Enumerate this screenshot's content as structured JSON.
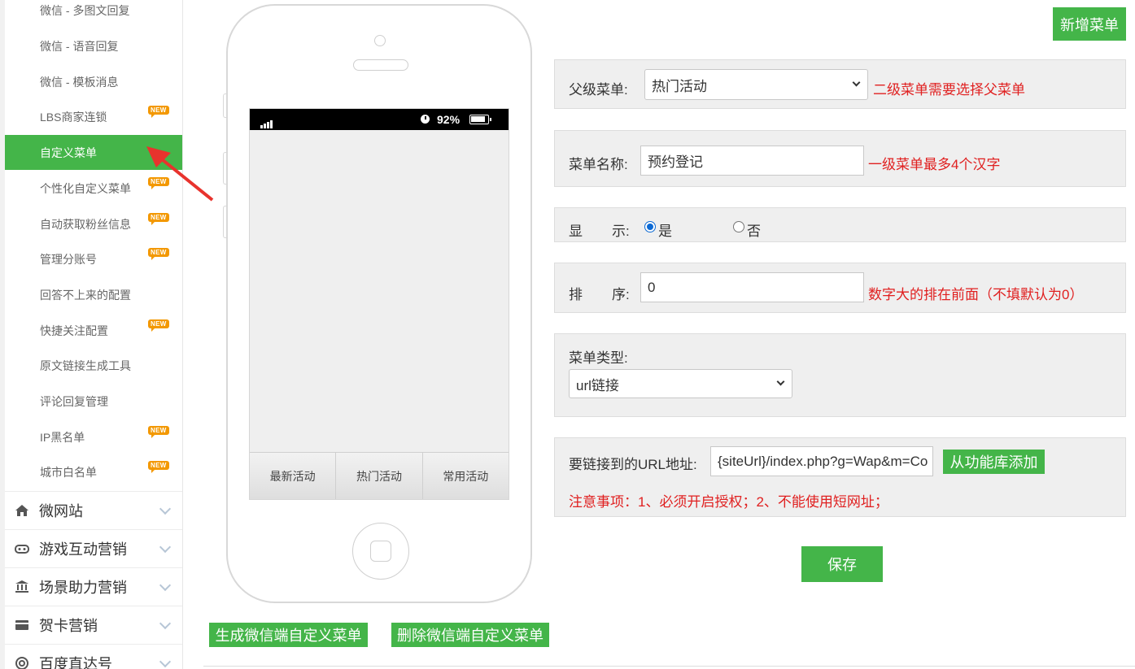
{
  "sidebar": {
    "sub_items": [
      {
        "label": "微信 - 多图文回复",
        "new": false,
        "active": false
      },
      {
        "label": "微信 - 语音回复",
        "new": false,
        "active": false
      },
      {
        "label": "微信 - 模板消息",
        "new": false,
        "active": false
      },
      {
        "label": "LBS商家连锁",
        "new": true,
        "active": false
      },
      {
        "label": "自定义菜单",
        "new": false,
        "active": true
      },
      {
        "label": "个性化自定义菜单",
        "new": true,
        "active": false
      },
      {
        "label": "自动获取粉丝信息",
        "new": true,
        "active": false
      },
      {
        "label": "管理分账号",
        "new": true,
        "active": false
      },
      {
        "label": "回答不上来的配置",
        "new": false,
        "active": false
      },
      {
        "label": "快捷关注配置",
        "new": true,
        "active": false
      },
      {
        "label": "原文链接生成工具",
        "new": false,
        "active": false
      },
      {
        "label": "评论回复管理",
        "new": false,
        "active": false
      },
      {
        "label": "IP黑名单",
        "new": true,
        "active": false
      },
      {
        "label": "城市白名单",
        "new": true,
        "active": false
      }
    ],
    "new_badge": "NEW",
    "categories": [
      {
        "label": "微网站",
        "icon": "home-icon"
      },
      {
        "label": "游戏互动营销",
        "icon": "gamepad-icon"
      },
      {
        "label": "场景助力营销",
        "icon": "bank-icon"
      },
      {
        "label": "贺卡营销",
        "icon": "card-icon"
      },
      {
        "label": "百度直达号",
        "icon": "at-icon"
      }
    ]
  },
  "phone": {
    "battery": "92%",
    "menu": [
      "最新活动",
      "热门活动",
      "常用活动"
    ]
  },
  "toolbar": {
    "add_menu": "新增菜单"
  },
  "form": {
    "parent_label": "父级菜单:",
    "parent_value": "热门活动",
    "parent_hint": "二级菜单需要选择父菜单",
    "name_label": "菜单名称:",
    "name_value": "预约登记",
    "name_hint": "一级菜单最多4个汉字",
    "show_label_1": "显",
    "show_label_2": "示:",
    "show_yes": "是",
    "show_no": "否",
    "sort_label_1": "排",
    "sort_label_2": "序:",
    "sort_value": "0",
    "sort_hint": "数字大的排在前面（不填默认为0）",
    "type_label": "菜单类型:",
    "type_value": "url链接",
    "url_label": "要链接到的URL地址:",
    "url_value": "{siteUrl}/index.php?g=Wap&m=Co",
    "lib_button": "从功能库添加",
    "notice": "注意事项：1、必须开启授权；2、不能使用短网址；",
    "save": "保存"
  },
  "actions": {
    "generate": "生成微信端自定义菜单",
    "delete": "删除微信端自定义菜单"
  },
  "colors": {
    "accent": "#44b549",
    "hint": "#e02020",
    "arrow": "#e8332d"
  }
}
